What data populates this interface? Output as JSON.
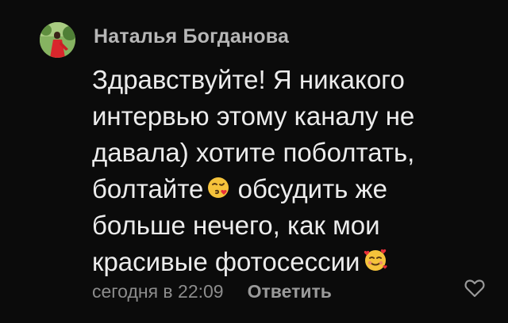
{
  "comment": {
    "author": "Наталья Богданова",
    "lines": [
      "Здравствуйте! Я никакого",
      "интервью этому каналу не",
      "давала) хотите поболтать,",
      "болтайте",
      " обсудить же",
      "больше нечего, как мои",
      "красивые фотосессии"
    ],
    "emojis": {
      "winking_kiss": "face-blowing-kiss-emoji",
      "smiling_hearts": "smiling-face-with-hearts-emoji"
    },
    "timestamp": "сегодня в 22:09",
    "reply_label": "Ответить",
    "like_icon": "heart-outline-icon"
  },
  "colors": {
    "background": "#0b0b0b",
    "author": "#b7b7b7",
    "text": "#ececec",
    "meta": "#8c8c8c",
    "emoji": "#f5c33b"
  }
}
